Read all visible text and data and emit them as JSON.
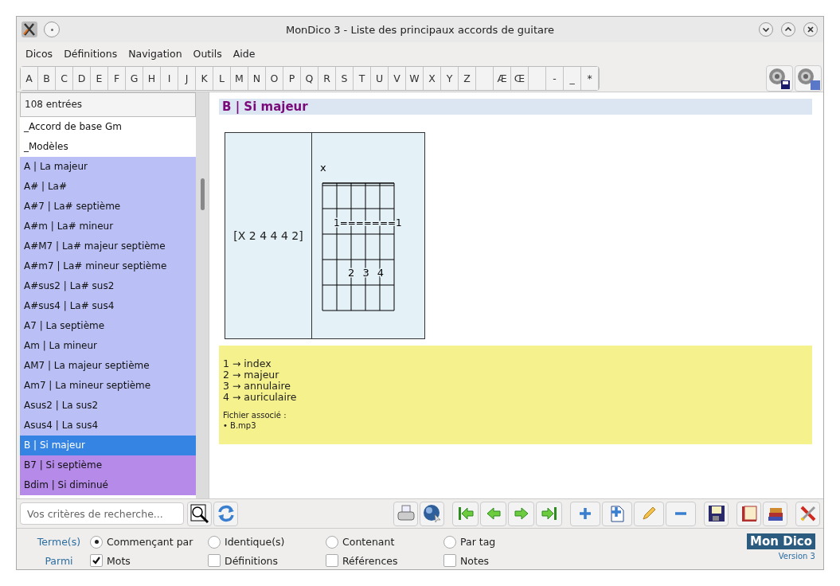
{
  "window": {
    "title": "MonDico 3 - Liste des principaux accords de guitare"
  },
  "menu": [
    "Dicos",
    "Définitions",
    "Navigation",
    "Outils",
    "Aide"
  ],
  "letter_keys": [
    {
      "kind": "letter",
      "label": "A"
    },
    {
      "kind": "letter",
      "label": "B"
    },
    {
      "kind": "letter",
      "label": "C"
    },
    {
      "kind": "letter",
      "label": "D"
    },
    {
      "kind": "letter",
      "label": "E"
    },
    {
      "kind": "letter",
      "label": "F"
    },
    {
      "kind": "letter",
      "label": "G"
    },
    {
      "kind": "letter",
      "label": "H"
    },
    {
      "kind": "letter",
      "label": "I"
    },
    {
      "kind": "letter",
      "label": "J"
    },
    {
      "kind": "letter",
      "label": "K"
    },
    {
      "kind": "letter",
      "label": "L"
    },
    {
      "kind": "letter",
      "label": "M"
    },
    {
      "kind": "letter",
      "label": "N"
    },
    {
      "kind": "letter",
      "label": "O"
    },
    {
      "kind": "letter",
      "label": "P"
    },
    {
      "kind": "letter",
      "label": "Q"
    },
    {
      "kind": "letter",
      "label": "R"
    },
    {
      "kind": "letter",
      "label": "S"
    },
    {
      "kind": "letter",
      "label": "T"
    },
    {
      "kind": "letter",
      "label": "U"
    },
    {
      "kind": "letter",
      "label": "V"
    },
    {
      "kind": "letter",
      "label": "W"
    },
    {
      "kind": "letter",
      "label": "X"
    },
    {
      "kind": "letter",
      "label": "Y"
    },
    {
      "kind": "letter",
      "label": "Z"
    },
    {
      "kind": "blank"
    },
    {
      "kind": "letter",
      "label": "Æ"
    },
    {
      "kind": "letter",
      "label": "Œ"
    },
    {
      "kind": "blank"
    },
    {
      "kind": "letter",
      "label": "-"
    },
    {
      "kind": "letter",
      "label": "_"
    },
    {
      "kind": "letter",
      "label": "*"
    }
  ],
  "entry_list": {
    "count": "108 entrées",
    "items": [
      {
        "label": "_Accord de base Gm",
        "color": "#ffffff",
        "selected": false
      },
      {
        "label": "_Modèles",
        "color": "#ffffff",
        "selected": false
      },
      {
        "label": "A | La majeur",
        "color": "#bac0f6",
        "selected": false
      },
      {
        "label": "A# | La#",
        "color": "#bac0f6",
        "selected": false
      },
      {
        "label": "A#7 | La# septième",
        "color": "#bac0f6",
        "selected": false
      },
      {
        "label": "A#m | La# mineur",
        "color": "#bac0f6",
        "selected": false
      },
      {
        "label": "A#M7 | La# majeur septième",
        "color": "#bac0f6",
        "selected": false
      },
      {
        "label": "A#m7 | La# mineur septième",
        "color": "#bac0f6",
        "selected": false
      },
      {
        "label": "A#sus2 | La# sus2",
        "color": "#bac0f6",
        "selected": false
      },
      {
        "label": "A#sus4 | La# sus4",
        "color": "#bac0f6",
        "selected": false
      },
      {
        "label": "A7 | La septième",
        "color": "#bac0f6",
        "selected": false
      },
      {
        "label": "Am | La mineur",
        "color": "#bac0f6",
        "selected": false
      },
      {
        "label": "AM7 | La majeur septième",
        "color": "#bac0f6",
        "selected": false
      },
      {
        "label": "Am7 | La mineur septième",
        "color": "#bac0f6",
        "selected": false
      },
      {
        "label": "Asus2 | La sus2",
        "color": "#bac0f6",
        "selected": false
      },
      {
        "label": "Asus4 | La sus4",
        "color": "#bac0f6",
        "selected": false
      },
      {
        "label": "B | Si majeur",
        "color": "#3584e4",
        "selected": true
      },
      {
        "label": "B7 | Si septième",
        "color": "#b58ae9",
        "selected": false
      },
      {
        "label": "Bdim | Si diminué",
        "color": "#b58ae9",
        "selected": false
      }
    ]
  },
  "entry": {
    "title": "B | Si majeur",
    "chord_notation": "[X 2 4 4 4 2]",
    "diagram": {
      "top_mark": "x",
      "barre": "1=======1",
      "fingers": "2 3 4"
    },
    "legend": [
      "1 → index",
      "2 → majeur",
      "3 → annulaire",
      "4 → auriculaire"
    ],
    "file_label": "Fichier associé :",
    "files": [
      "• B.mp3"
    ]
  },
  "search": {
    "placeholder": "Vos critères de recherche..."
  },
  "terms": {
    "label": "Terme(s)",
    "options": [
      {
        "label": "Commençant par",
        "selected": true
      },
      {
        "label": "Identique(s)",
        "selected": false
      },
      {
        "label": "Contenant",
        "selected": false
      },
      {
        "label": "Par tag",
        "selected": false
      }
    ]
  },
  "among": {
    "label": "Parmi",
    "options": [
      {
        "label": "Mots",
        "checked": true
      },
      {
        "label": "Définitions",
        "checked": false
      },
      {
        "label": "Références",
        "checked": false
      },
      {
        "label": "Notes",
        "checked": false
      }
    ]
  },
  "logo": {
    "name": "Mon Dico",
    "version": "Version 3"
  }
}
